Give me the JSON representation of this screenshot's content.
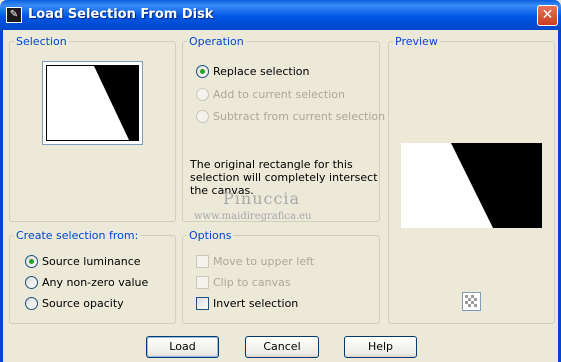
{
  "window": {
    "title": "Load Selection From Disk",
    "close_glyph": "✕",
    "app_icon_glyph": "✎"
  },
  "selection_group": {
    "label": "Selection"
  },
  "operation_group": {
    "label": "Operation",
    "options": [
      {
        "label": "Replace selection",
        "checked": true,
        "enabled": true
      },
      {
        "label": "Add to current selection",
        "checked": false,
        "enabled": false
      },
      {
        "label": "Subtract from current selection",
        "checked": false,
        "enabled": false
      }
    ],
    "info": "The original rectangle for this selection will completely intersect the canvas."
  },
  "preview_group": {
    "label": "Preview"
  },
  "create_group": {
    "label": "Create selection from:",
    "options": [
      {
        "label": "Source luminance",
        "checked": true
      },
      {
        "label": "Any non-zero value",
        "checked": false
      },
      {
        "label": "Source opacity",
        "checked": false
      }
    ]
  },
  "options_group": {
    "label": "Options",
    "checks": [
      {
        "label": "Move to upper left",
        "checked": false,
        "enabled": false
      },
      {
        "label": "Clip to canvas",
        "checked": false,
        "enabled": false
      },
      {
        "label": "Invert selection",
        "checked": false,
        "enabled": true
      }
    ]
  },
  "watermark": {
    "line1": "Pinuccia",
    "line2": "www.maidiregrafica.eu"
  },
  "buttons": {
    "load": "Load",
    "cancel": "Cancel",
    "help": "Help"
  },
  "icons": {
    "preview_toggle": "checkerboard-icon"
  }
}
